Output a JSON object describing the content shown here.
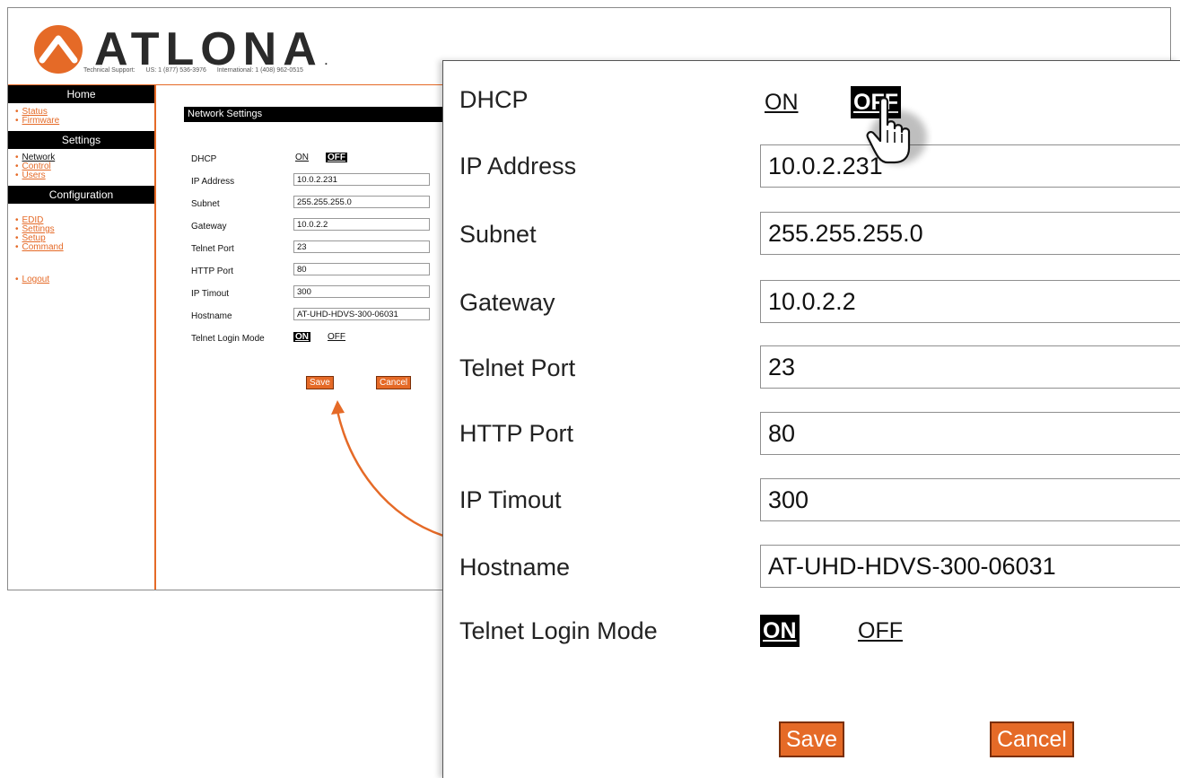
{
  "brand": {
    "name": "ATLONA",
    "registered_mark": ".",
    "support_label": "Technical Support:",
    "support_us": "US: 1 (877) 536-3976",
    "support_intl": "International: 1 (408) 962-0515",
    "accent_color": "#e56a27"
  },
  "sidebar": {
    "home_header": "Home",
    "home_items": [
      "Status",
      "Firmware"
    ],
    "settings_header": "Settings",
    "settings_items": [
      "Network",
      "Control",
      "Users"
    ],
    "active_item": "Network",
    "config_header": "Configuration",
    "config_items": [
      "EDID",
      "Settings",
      "Setup",
      "Command"
    ],
    "logout": "Logout"
  },
  "network": {
    "title": "Network Settings",
    "dhcp_label": "DHCP",
    "dhcp_on": "ON",
    "dhcp_off": "OFF",
    "dhcp_selected": "OFF",
    "ip_label": "IP Address",
    "ip_value": "10.0.2.231",
    "subnet_label": "Subnet",
    "subnet_value": "255.255.255.0",
    "gateway_label": "Gateway",
    "gateway_value": "10.0.2.2",
    "telnet_port_label": "Telnet Port",
    "telnet_port_value": "23",
    "http_port_label": "HTTP Port",
    "http_port_value": "80",
    "timeout_label": "IP Timout",
    "timeout_value": "300",
    "hostname_label": "Hostname",
    "hostname_value": "AT-UHD-HDVS-300-06031",
    "telnet_login_label": "Telnet Login Mode",
    "telnet_on": "ON",
    "telnet_off": "OFF",
    "telnet_selected": "ON",
    "save_label": "Save",
    "cancel_label": "Cancel"
  }
}
